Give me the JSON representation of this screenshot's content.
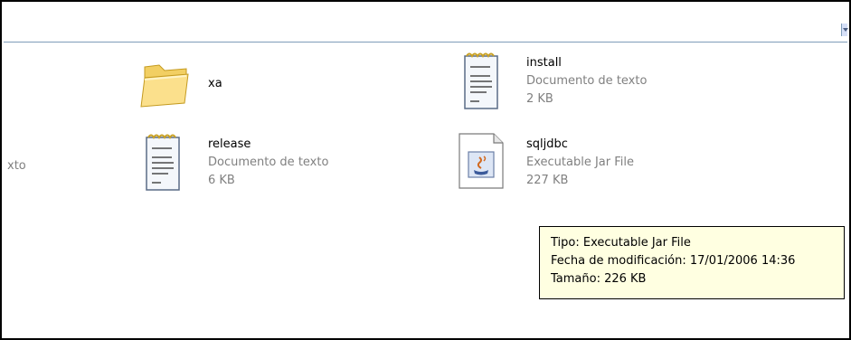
{
  "partial_label": "xto",
  "items": [
    {
      "name": "xa",
      "icon": "folder-icon"
    },
    {
      "name": "install",
      "type": "Documento de texto",
      "size": "2 KB",
      "icon": "text-document-icon"
    },
    {
      "name": "release",
      "type": "Documento de texto",
      "size": "6 KB",
      "icon": "text-document-icon"
    },
    {
      "name": "sqljdbc",
      "type": "Executable Jar File",
      "size": "227 KB",
      "icon": "jar-file-icon"
    }
  ],
  "tooltip": {
    "line1": "Tipo: Executable Jar File",
    "line2": "Fecha de modificación: 17/01/2006 14:36",
    "line3": "Tamaño: 226 KB"
  }
}
